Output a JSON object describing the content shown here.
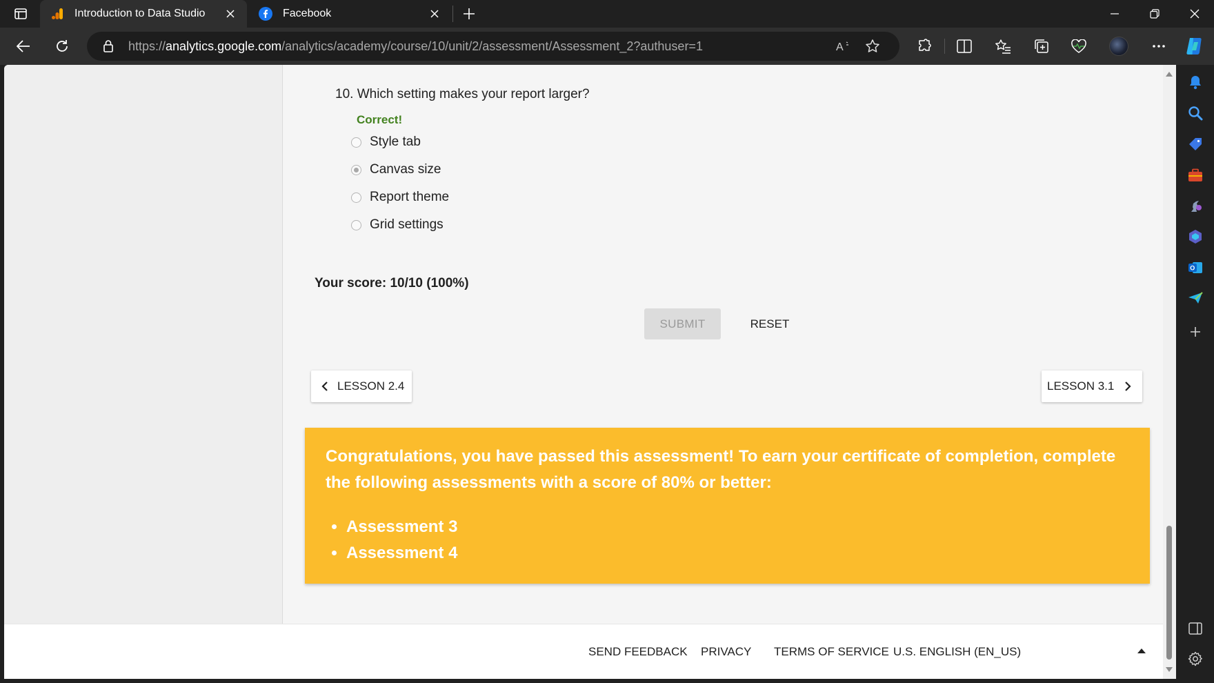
{
  "browser": {
    "tabs": [
      {
        "title": "Introduction to Data Studio",
        "icon": "analytics-favicon",
        "active": true
      },
      {
        "title": "Facebook",
        "icon": "facebook-favicon",
        "active": false
      }
    ],
    "address": {
      "scheme": "https://",
      "host": "analytics.google.com",
      "path": "/analytics/academy/course/10/unit/2/assessment/Assessment_2?authuser=1"
    }
  },
  "quiz": {
    "question": "10. Which setting makes your report larger?",
    "feedback": "Correct!",
    "options": [
      {
        "label": "Style tab",
        "selected": false
      },
      {
        "label": "Canvas size",
        "selected": true
      },
      {
        "label": "Report theme",
        "selected": false
      },
      {
        "label": "Grid settings",
        "selected": false
      }
    ],
    "score": "Your score: 10/10 (100%)",
    "submit_label": "SUBMIT",
    "reset_label": "RESET"
  },
  "navigation": {
    "prev_label": "LESSON 2.4",
    "next_label": "LESSON 3.1"
  },
  "banner": {
    "text": "Congratulations, you have passed this assessment! To earn your certificate of completion, complete the following assessments with a score of 80% or better:",
    "items": [
      "Assessment 3",
      "Assessment 4"
    ],
    "color": "#fbbc2c"
  },
  "footer": {
    "send_feedback": "SEND FEEDBACK",
    "privacy": "PRIVACY",
    "terms": "TERMS OF SERVICE",
    "language": "U.S. ENGLISH (EN_US)"
  },
  "colors": {
    "correct": "#43821f",
    "browser_dark": "#202020",
    "toolbar": "#2f2f2f"
  }
}
